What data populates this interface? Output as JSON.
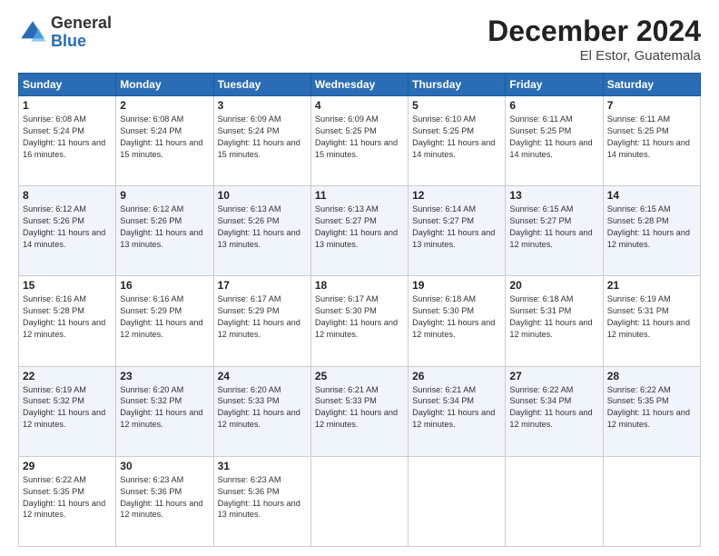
{
  "logo": {
    "general": "General",
    "blue": "Blue"
  },
  "header": {
    "month": "December 2024",
    "location": "El Estor, Guatemala"
  },
  "weekdays": [
    "Sunday",
    "Monday",
    "Tuesday",
    "Wednesday",
    "Thursday",
    "Friday",
    "Saturday"
  ],
  "weeks": [
    [
      {
        "day": 1,
        "sunrise": "6:08 AM",
        "sunset": "5:24 PM",
        "daylight": "11 hours and 16 minutes."
      },
      {
        "day": 2,
        "sunrise": "6:08 AM",
        "sunset": "5:24 PM",
        "daylight": "11 hours and 15 minutes."
      },
      {
        "day": 3,
        "sunrise": "6:09 AM",
        "sunset": "5:24 PM",
        "daylight": "11 hours and 15 minutes."
      },
      {
        "day": 4,
        "sunrise": "6:09 AM",
        "sunset": "5:25 PM",
        "daylight": "11 hours and 15 minutes."
      },
      {
        "day": 5,
        "sunrise": "6:10 AM",
        "sunset": "5:25 PM",
        "daylight": "11 hours and 14 minutes."
      },
      {
        "day": 6,
        "sunrise": "6:11 AM",
        "sunset": "5:25 PM",
        "daylight": "11 hours and 14 minutes."
      },
      {
        "day": 7,
        "sunrise": "6:11 AM",
        "sunset": "5:25 PM",
        "daylight": "11 hours and 14 minutes."
      }
    ],
    [
      {
        "day": 8,
        "sunrise": "6:12 AM",
        "sunset": "5:26 PM",
        "daylight": "11 hours and 14 minutes."
      },
      {
        "day": 9,
        "sunrise": "6:12 AM",
        "sunset": "5:26 PM",
        "daylight": "11 hours and 13 minutes."
      },
      {
        "day": 10,
        "sunrise": "6:13 AM",
        "sunset": "5:26 PM",
        "daylight": "11 hours and 13 minutes."
      },
      {
        "day": 11,
        "sunrise": "6:13 AM",
        "sunset": "5:27 PM",
        "daylight": "11 hours and 13 minutes."
      },
      {
        "day": 12,
        "sunrise": "6:14 AM",
        "sunset": "5:27 PM",
        "daylight": "11 hours and 13 minutes."
      },
      {
        "day": 13,
        "sunrise": "6:15 AM",
        "sunset": "5:27 PM",
        "daylight": "11 hours and 12 minutes."
      },
      {
        "day": 14,
        "sunrise": "6:15 AM",
        "sunset": "5:28 PM",
        "daylight": "11 hours and 12 minutes."
      }
    ],
    [
      {
        "day": 15,
        "sunrise": "6:16 AM",
        "sunset": "5:28 PM",
        "daylight": "11 hours and 12 minutes."
      },
      {
        "day": 16,
        "sunrise": "6:16 AM",
        "sunset": "5:29 PM",
        "daylight": "11 hours and 12 minutes."
      },
      {
        "day": 17,
        "sunrise": "6:17 AM",
        "sunset": "5:29 PM",
        "daylight": "11 hours and 12 minutes."
      },
      {
        "day": 18,
        "sunrise": "6:17 AM",
        "sunset": "5:30 PM",
        "daylight": "11 hours and 12 minutes."
      },
      {
        "day": 19,
        "sunrise": "6:18 AM",
        "sunset": "5:30 PM",
        "daylight": "11 hours and 12 minutes."
      },
      {
        "day": 20,
        "sunrise": "6:18 AM",
        "sunset": "5:31 PM",
        "daylight": "11 hours and 12 minutes."
      },
      {
        "day": 21,
        "sunrise": "6:19 AM",
        "sunset": "5:31 PM",
        "daylight": "11 hours and 12 minutes."
      }
    ],
    [
      {
        "day": 22,
        "sunrise": "6:19 AM",
        "sunset": "5:32 PM",
        "daylight": "11 hours and 12 minutes."
      },
      {
        "day": 23,
        "sunrise": "6:20 AM",
        "sunset": "5:32 PM",
        "daylight": "11 hours and 12 minutes."
      },
      {
        "day": 24,
        "sunrise": "6:20 AM",
        "sunset": "5:33 PM",
        "daylight": "11 hours and 12 minutes."
      },
      {
        "day": 25,
        "sunrise": "6:21 AM",
        "sunset": "5:33 PM",
        "daylight": "11 hours and 12 minutes."
      },
      {
        "day": 26,
        "sunrise": "6:21 AM",
        "sunset": "5:34 PM",
        "daylight": "11 hours and 12 minutes."
      },
      {
        "day": 27,
        "sunrise": "6:22 AM",
        "sunset": "5:34 PM",
        "daylight": "11 hours and 12 minutes."
      },
      {
        "day": 28,
        "sunrise": "6:22 AM",
        "sunset": "5:35 PM",
        "daylight": "11 hours and 12 minutes."
      }
    ],
    [
      {
        "day": 29,
        "sunrise": "6:22 AM",
        "sunset": "5:35 PM",
        "daylight": "11 hours and 12 minutes."
      },
      {
        "day": 30,
        "sunrise": "6:23 AM",
        "sunset": "5:36 PM",
        "daylight": "11 hours and 12 minutes."
      },
      {
        "day": 31,
        "sunrise": "6:23 AM",
        "sunset": "5:36 PM",
        "daylight": "11 hours and 13 minutes."
      },
      null,
      null,
      null,
      null
    ]
  ],
  "labels": {
    "sunrise_prefix": "Sunrise: ",
    "sunset_prefix": "Sunset: ",
    "daylight_prefix": "Daylight: "
  }
}
